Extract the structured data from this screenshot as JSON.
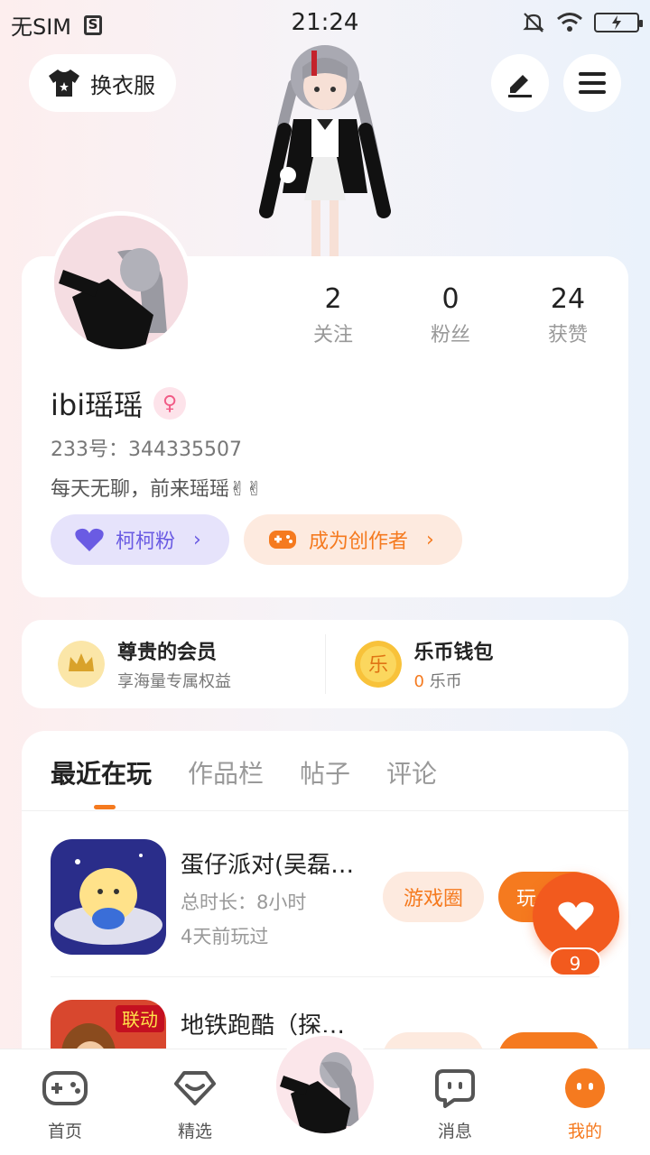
{
  "status_bar": {
    "carrier": "无SIM",
    "time": "21:24"
  },
  "header": {
    "outfit_label": "换衣服"
  },
  "profile": {
    "stats": [
      {
        "value": "2",
        "label": "关注"
      },
      {
        "value": "0",
        "label": "粉丝"
      },
      {
        "value": "24",
        "label": "获赞"
      }
    ],
    "username": "ibi瑶瑶",
    "uid": "233号：344335507",
    "bio": "每天无聊，前来瑶瑶✌✌",
    "fan_pill": "柯柯粉",
    "creator_pill": "成为创作者"
  },
  "wallet": {
    "vip_title": "尊贵的会员",
    "vip_sub": "享海量专属权益",
    "coin_title": "乐币钱包",
    "coin_amount": "0",
    "coin_unit": "乐币",
    "coin_glyph": "乐"
  },
  "tabs": [
    "最近在玩",
    "作品栏",
    "帖子",
    "评论"
  ],
  "games": [
    {
      "name": "蛋仔派对(吴磊…",
      "total": "总时长：8小时",
      "last": "4天前玩过",
      "circle_btn": "游戏圈",
      "play_btn": "玩"
    },
    {
      "name": "地铁跑酷（探…",
      "badge": "联动"
    }
  ],
  "like_count": "9",
  "bottom_nav": {
    "home": "首页",
    "featured": "精选",
    "messages": "消息",
    "mine": "我的"
  },
  "colors": {
    "accent": "#f57a1f",
    "like": "#f25a1e",
    "fan": "#6a5be3"
  }
}
